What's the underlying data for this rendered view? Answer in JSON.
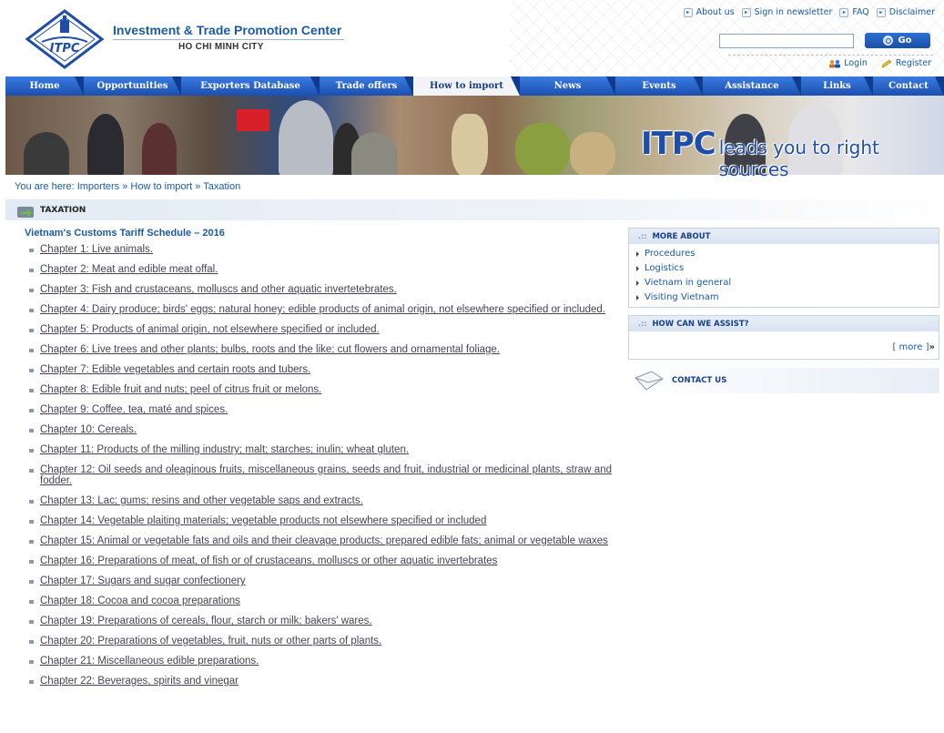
{
  "header": {
    "org_name": "Investment & Trade Promotion Center",
    "org_city": "HO CHI MINH CITY",
    "logo_text": "ITPC",
    "top_links": [
      "About us",
      "Sign in newsletter",
      "FAQ",
      "Disclaimer"
    ],
    "search_value": "",
    "go_label": "Go",
    "login_label": "Login",
    "register_label": "Register"
  },
  "nav": {
    "items": [
      {
        "label": "Home",
        "active": false
      },
      {
        "label": "Opportunities",
        "active": false
      },
      {
        "label": "Exporters Database",
        "active": false
      },
      {
        "label": "Trade offers",
        "active": false
      },
      {
        "label": "How to import",
        "active": true
      },
      {
        "label": "News",
        "active": false
      },
      {
        "label": "Events",
        "active": false
      },
      {
        "label": "Assistance",
        "active": false
      },
      {
        "label": "Links",
        "active": false
      },
      {
        "label": "Contact",
        "active": false
      }
    ]
  },
  "banner": {
    "brand": "ITPC",
    "slogan": "leads you to right sources"
  },
  "breadcrumb": "You are here: Importers » How to import » Taxation",
  "section_title": "TAXATION",
  "main": {
    "title": "Vietnam's Customs Tariff Schedule – 2016",
    "chapters": [
      "Chapter 1: Live animals.",
      "Chapter 2: Meat and edible meat offal.",
      "Chapter 3: Fish and crustaceans, molluscs and other aquatic invertetebrates.",
      "Chapter 4: Dairy produce; birds' eggs; natural honey; edible products of animal origin, not elsewhere specified or included.",
      "Chapter 5: Products of animal origin, not elsewhere specified or included.",
      "Chapter 6: Live trees and other plants; bulbs, roots and the like; cut flowers and ornamental foliage.",
      "Chapter 7: Edible vegetables and certain roots and tubers.",
      "Chapter 8: Edible fruit and nuts; peel of citrus fruit or melons.",
      "Chapter 9: Coffee, tea, maté and spices.",
      "Chapter 10: Cereals.",
      "Chapter 11: Products of the milling industry; malt; starches; inulin; wheat gluten.",
      "Chapter 12: Oil seeds and oleaginous fruits, miscellaneous grains, seeds and fruit, industrial or medicinal plants, straw and fodder.",
      "Chapter 13: Lac; gums; resins and other vegetable saps and extracts.",
      "Chapter 14: Vegetable plaiting materials; vegetable products not elsewhere specified or included",
      "Chapter 15: Animal or vegetable fats and oils and their cleavage products; prepared edible fats; animal or vegetable waxes",
      "Chapter 16: Preparations of meat, of fish or of crustaceans, molluscs or other aquatic invertebrates",
      "Chapter 17: Sugars and sugar confectionery",
      "Chapter 18: Cocoa and cocoa preparations",
      "Chapter 19: Preparations of cereals, flour, starch or milk; bakers' wares.",
      "Chapter 20: Preparations of vegetables, fruit, nuts or other parts of plants.",
      "Chapter 21: Miscellaneous edible preparations.",
      "Chapter 22: Beverages, spirits and vinegar"
    ]
  },
  "sidebar": {
    "more_about_title": "MORE ABOUT",
    "more_about_items": [
      "Procedures",
      "Logistics",
      "Vietnam in general",
      "Visiting Vietnam"
    ],
    "assist_title": "HOW CAN WE ASSIST?",
    "more_link": "[ more ]",
    "contact_label": "CONTACT US"
  },
  "colors": {
    "brand_blue": "#1a5aa8",
    "nav_blue": "#2a63c6"
  }
}
